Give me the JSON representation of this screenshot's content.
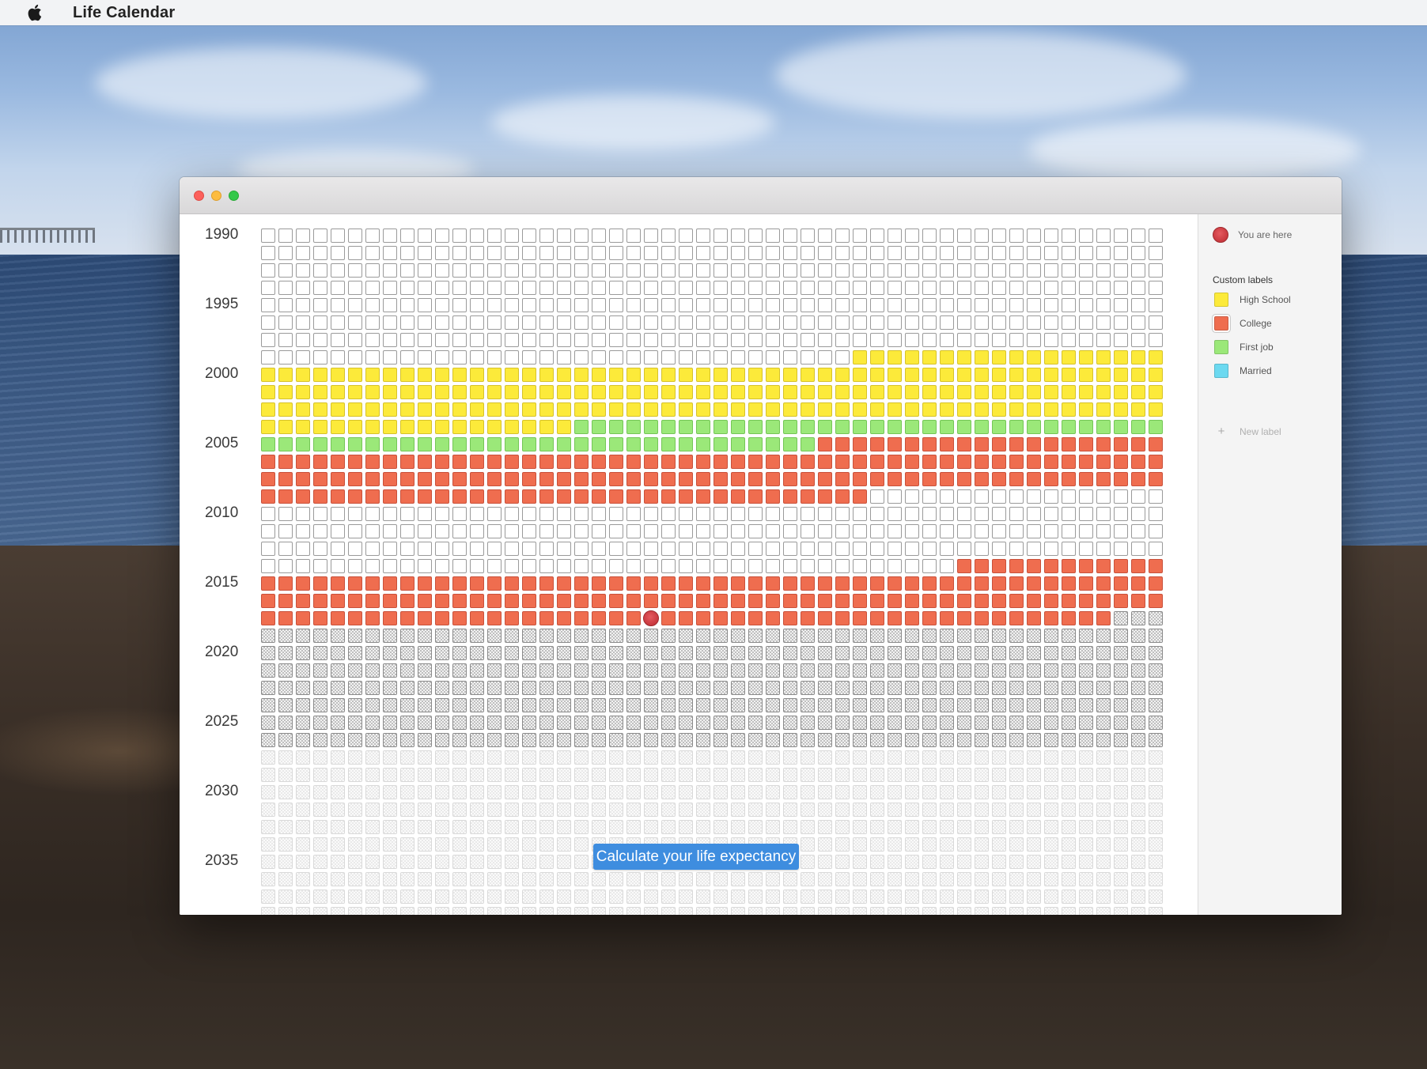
{
  "menubar": {
    "app_name": "Life Calendar"
  },
  "calendar": {
    "year_labels": [
      "1990",
      "1995",
      "2000",
      "2005",
      "2010",
      "2015",
      "2020",
      "2025",
      "2030",
      "2035"
    ],
    "weeks_per_row": 52,
    "rows": 40,
    "current_week": {
      "row": 22,
      "col": 22
    },
    "colors": {
      "empty": "#ffffff",
      "high_school": "#fcea3a",
      "college": "#ef6d4f",
      "first_job": "#9be879",
      "married": "#6cd9f0",
      "you_are_here": "#d0393f"
    }
  },
  "actions": {
    "calculate_label": "Calculate your life expectancy"
  },
  "sidebar": {
    "you_are_here": "You are here",
    "custom_labels_heading": "Custom labels",
    "labels": [
      {
        "name": "High School",
        "color": "#fcea3a"
      },
      {
        "name": "College",
        "color": "#ef6d4f"
      },
      {
        "name": "First job",
        "color": "#9be879"
      },
      {
        "name": "Married",
        "color": "#6cd9f0"
      }
    ],
    "new_label": "New label"
  }
}
